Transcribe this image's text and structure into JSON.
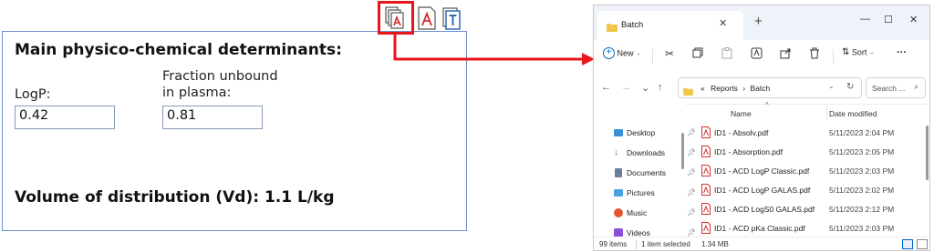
{
  "left_panel": {
    "title": "Main physico-chemical determinants:",
    "logp_label": "LogP:",
    "logp_value": "0.42",
    "fu_label_line1": "Fraction unbound",
    "fu_label_line2": "in plasma:",
    "fu_value": "0.81",
    "vd_text": "Volume of distribution (Vd): 1.1 L/kg",
    "highlight_color": "#e8151b"
  },
  "explorer": {
    "tab_title": "Batch",
    "new_label": "New",
    "sort_label": "Sort",
    "more_label": "···",
    "breadcrumb_prefix": "«",
    "breadcrumb_1": "Reports",
    "breadcrumb_sep": "›",
    "breadcrumb_2": "Batch",
    "search_placeholder": "Search ...",
    "col_name": "Name",
    "col_date": "Date modified",
    "nav_items": [
      {
        "label": "Desktop",
        "icon": "desktop-icon"
      },
      {
        "label": "Downloads",
        "icon": "download-icon"
      },
      {
        "label": "Documents",
        "icon": "documents-icon"
      },
      {
        "label": "Pictures",
        "icon": "pictures-icon"
      },
      {
        "label": "Music",
        "icon": "music-icon"
      },
      {
        "label": "Videos",
        "icon": "videos-icon"
      }
    ],
    "files": [
      {
        "name": "ID1 - Absolv.pdf",
        "date": "5/11/2023 2:04 PM"
      },
      {
        "name": "ID1 - Absorption.pdf",
        "date": "5/11/2023 2:05 PM"
      },
      {
        "name": "ID1 - ACD LogP Classic.pdf",
        "date": "5/11/2023 2:03 PM"
      },
      {
        "name": "ID1 - ACD LogP GALAS.pdf",
        "date": "5/11/2023 2:02 PM"
      },
      {
        "name": "ID1 - ACD LogS0 GALAS.pdf",
        "date": "5/11/2023 2:12 PM"
      },
      {
        "name": "ID1 - ACD pKa Classic.pdf",
        "date": "5/11/2023 2:03 PM"
      }
    ],
    "status_count": "99 items",
    "status_selected": "1 item selected",
    "status_size": "1.34 MB",
    "accent_color": "#0067c0",
    "folder_color": "#f3c64a",
    "pdf_color": "#d32f2f"
  }
}
